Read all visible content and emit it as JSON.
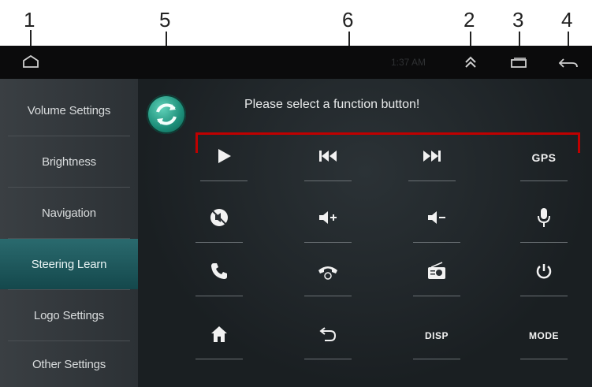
{
  "callouts": [
    "1",
    "2",
    "3",
    "4",
    "5",
    "6"
  ],
  "statusbar": {
    "home_icon": "home-outline-icon",
    "clock": "1:37 AM",
    "up_icon": "chevron-up-icon",
    "recent_icon": "recent-apps-icon",
    "back_icon": "back-arrow-icon"
  },
  "sidebar": {
    "items": [
      {
        "label": "Volume Settings"
      },
      {
        "label": "Brightness"
      },
      {
        "label": "Navigation"
      },
      {
        "label": "Steering Learn",
        "active": true
      },
      {
        "label": "Logo Settings"
      },
      {
        "label": "Other Settings"
      }
    ]
  },
  "main": {
    "refresh_icon": "refresh-icon",
    "prompt": "Please select a function button!",
    "buttons": [
      {
        "name": "play",
        "icon": "play-icon"
      },
      {
        "name": "previous",
        "icon": "skip-previous-icon"
      },
      {
        "name": "next",
        "icon": "skip-next-icon"
      },
      {
        "name": "gps",
        "text": "GPS"
      },
      {
        "name": "mute",
        "icon": "mute-icon"
      },
      {
        "name": "volume-up",
        "icon": "volume-up-icon"
      },
      {
        "name": "volume-down",
        "icon": "volume-down-icon"
      },
      {
        "name": "mic",
        "icon": "microphone-icon"
      },
      {
        "name": "call",
        "icon": "phone-icon"
      },
      {
        "name": "hang-up",
        "icon": "hang-up-icon"
      },
      {
        "name": "radio",
        "icon": "radio-icon"
      },
      {
        "name": "power",
        "icon": "power-icon"
      },
      {
        "name": "home",
        "icon": "home-icon"
      },
      {
        "name": "back",
        "icon": "back-icon"
      },
      {
        "name": "disp",
        "text": "DISP"
      },
      {
        "name": "mode",
        "text": "MODE"
      }
    ]
  },
  "colors": {
    "accent": "#1d8f7a",
    "active_item": "#1f5a5e",
    "callout_bracket": "#c00000"
  }
}
